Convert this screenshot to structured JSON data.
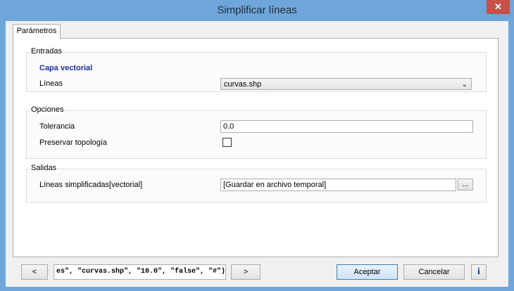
{
  "window": {
    "title": "Simplificar líneas",
    "close_glyph": "✕"
  },
  "tabs": [
    {
      "label": "Parámetros"
    }
  ],
  "entradas": {
    "label": "Entradas",
    "capa_vectorial": "Capa vectorial",
    "lineas_label": "Líneas",
    "lineas_value": "curvas.shp"
  },
  "opciones": {
    "label": "Opciones",
    "tolerancia_label": "Tolerancia",
    "tolerancia_value": "0.0",
    "preservar_label": "Preservar topología",
    "preservar_checked": false
  },
  "salidas": {
    "label": "Salidas",
    "lineas_simplificadas_label": "Líneas simplificadas[vectorial]",
    "output_value": "[Guardar en archivo temporal]",
    "browse_label": "..."
  },
  "footer": {
    "prev_label": "<",
    "next_label": ">",
    "command_text": "es\", \"curvas.shp\", \"10.0\", \"false\", \"#\")",
    "accept_label": "Aceptar",
    "cancel_label": "Cancelar",
    "info_label": "i"
  }
}
